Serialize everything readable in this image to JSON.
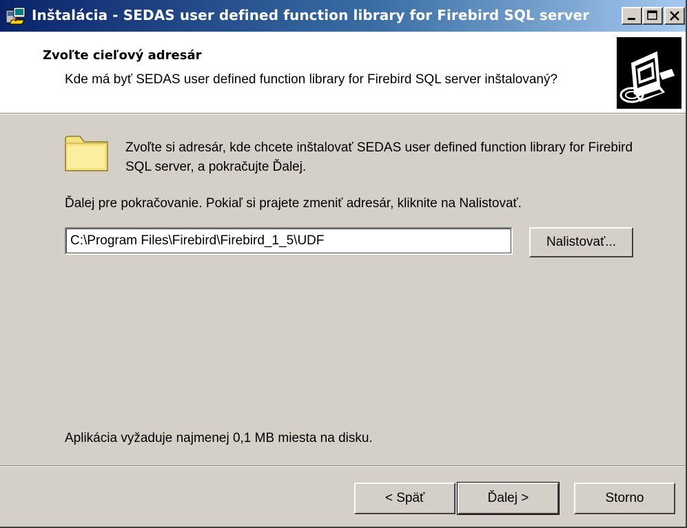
{
  "window": {
    "title": "Inštalácia - SEDAS user defined function library for Firebird SQL server",
    "icons": [
      "installer-app-icon",
      "minimize-icon",
      "maximize-icon",
      "close-icon"
    ]
  },
  "header": {
    "title": "Zvoľte cieľový adresár",
    "subtitle": "Kde má byť SEDAS user defined function library for Firebird SQL server inštalovaný?"
  },
  "body": {
    "intro": "Zvoľte si adresár, kde chcete inštalovať SEDAS user defined function library for Firebird SQL server, a pokračujte Ďalej.",
    "instruction": "Ďalej pre pokračovanie. Pokiaľ si prajete zmeniť adresár, kliknite na Nalistovať.",
    "path_value": "C:\\Program Files\\Firebird\\Firebird_1_5\\UDF",
    "browse_label": "Nalistovať...",
    "disk_space": "Aplikácia vyžaduje najmenej 0,1 MB miesta na disku."
  },
  "footer": {
    "back_label": "< Späť",
    "next_label": "Ďalej >",
    "cancel_label": "Storno"
  }
}
